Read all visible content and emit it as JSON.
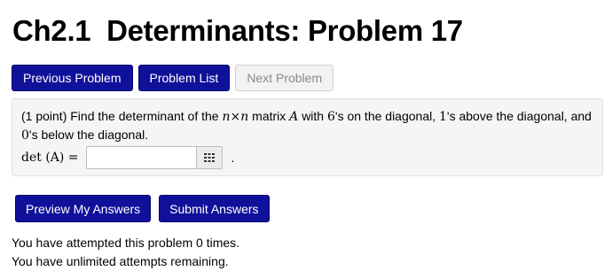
{
  "header": {
    "title": "Ch2.1  Determinants: Problem 17"
  },
  "nav": {
    "previous_label": "Previous Problem",
    "list_label": "Problem List",
    "next_label": "Next Problem"
  },
  "problem": {
    "points": "(1 point)",
    "text_1": "Find the determinant of the",
    "var_n1": "n",
    "times": "×",
    "var_n2": "n",
    "text_2": "matrix",
    "var_A": "A",
    "text_3": "with",
    "num_6": "6",
    "text_4": "'s on the diagonal,",
    "num_1": "1",
    "text_5": "'s above the diagonal, and",
    "num_0": "0",
    "text_6": "'s below the diagonal.",
    "answer_label": "det (A) =",
    "answer_value": "",
    "period": "."
  },
  "actions": {
    "preview_label": "Preview My Answers",
    "submit_label": "Submit Answers"
  },
  "status": {
    "attempts_line": "You have attempted this problem 0 times.",
    "remaining_line": "You have unlimited attempts remaining."
  },
  "icons": {
    "matrix_button_icon": "grid-icon"
  },
  "colors": {
    "primary_button": "#10119a",
    "disabled_button": "#f2f2f2",
    "problem_background": "#f5f5f5"
  }
}
